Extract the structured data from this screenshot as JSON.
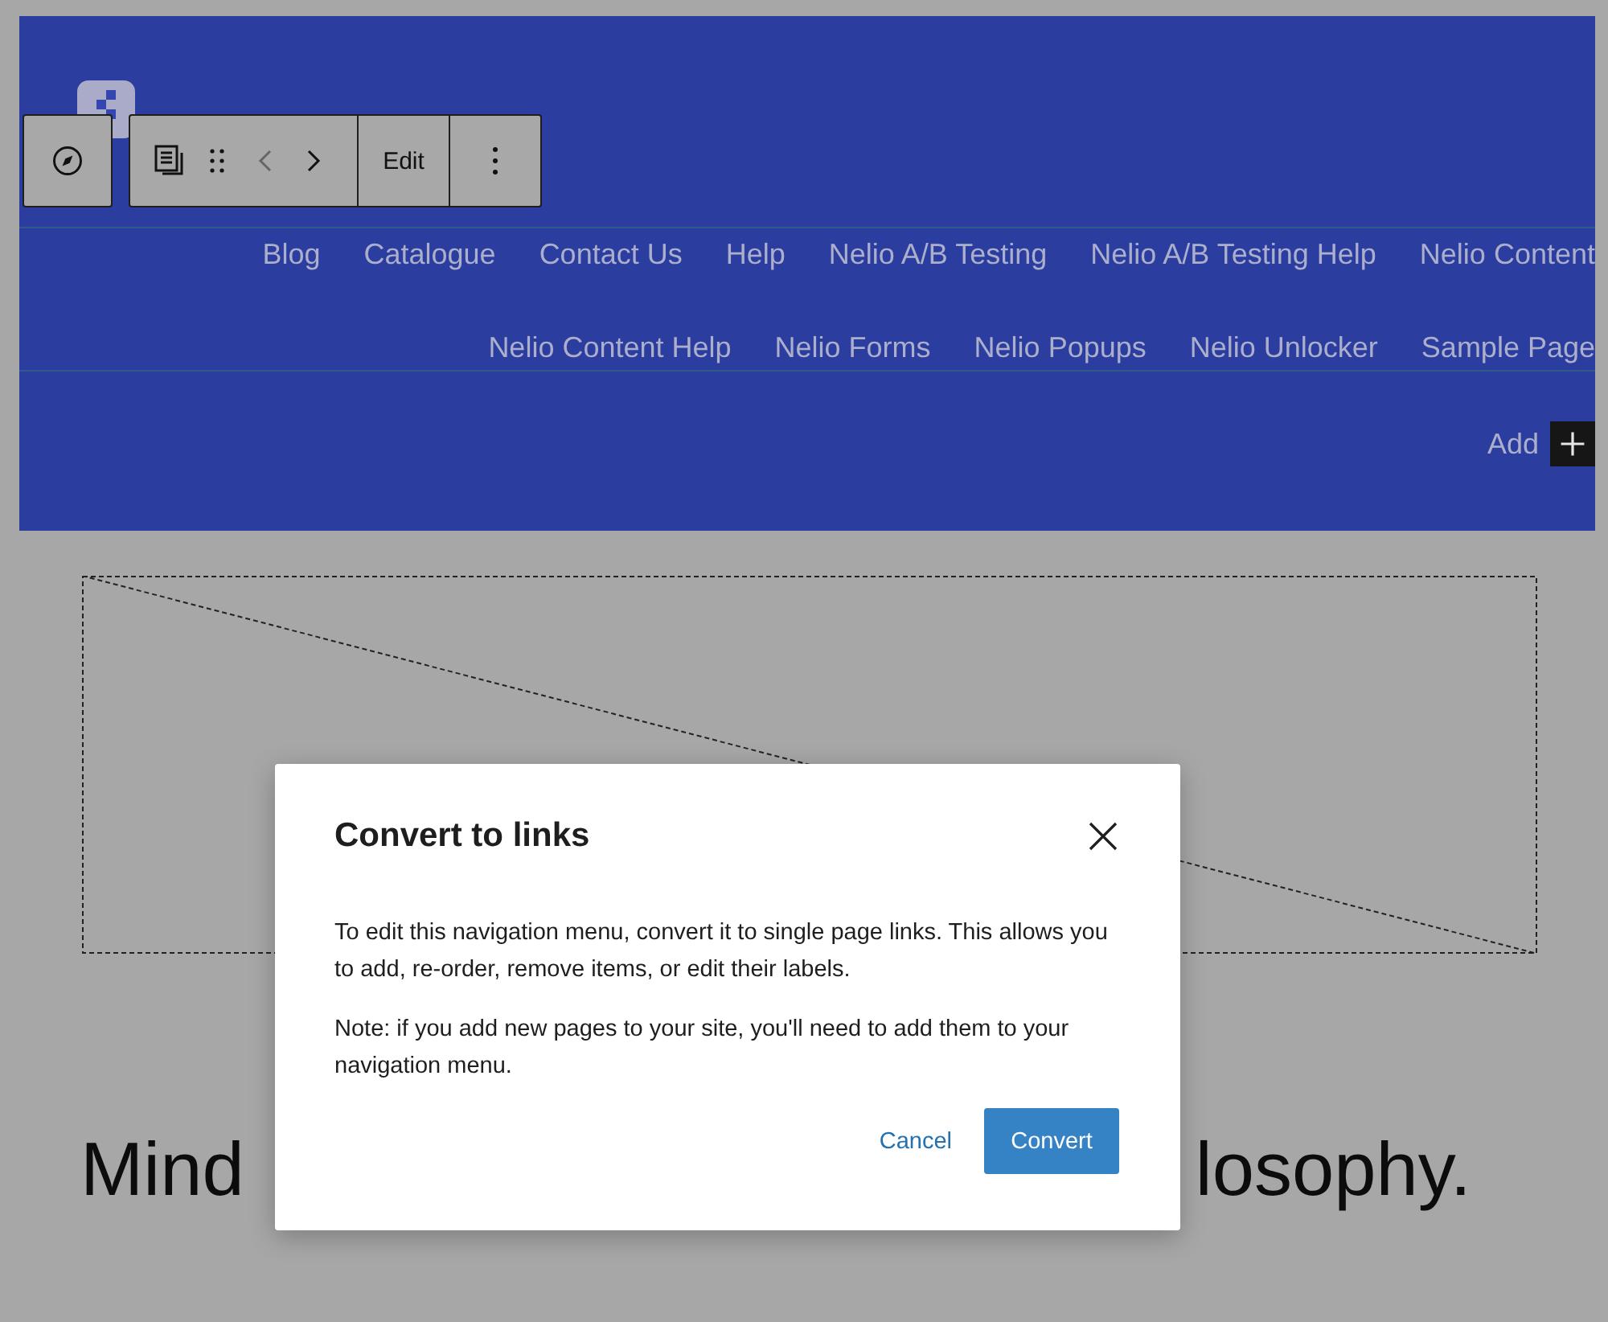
{
  "block_toolbar": {
    "edit_label": "Edit"
  },
  "navigation": {
    "lines": [
      {
        "links": [
          "Blog",
          "Catalogue",
          "Contact Us",
          "Help",
          "Nelio A/B Testing",
          "Nelio A/B Testing Help",
          "Nelio Content"
        ]
      },
      {
        "links": [
          "Nelio Content Help",
          "Nelio Forms",
          "Nelio Popups",
          "Nelio Unlocker",
          "Sample Page"
        ]
      }
    ],
    "add_label": "Add"
  },
  "heading": {
    "visible_start": "Mind",
    "visible_end": "losophy."
  },
  "dialog": {
    "title": "Convert to links",
    "paragraphs": [
      "To edit this navigation menu, convert it to single page links. This allows you to add, re-order, remove items, or edit their labels.",
      "Note: if you add new pages to your site, you'll need to add them to your navigation menu."
    ],
    "cancel": "Cancel",
    "confirm": "Convert"
  }
}
